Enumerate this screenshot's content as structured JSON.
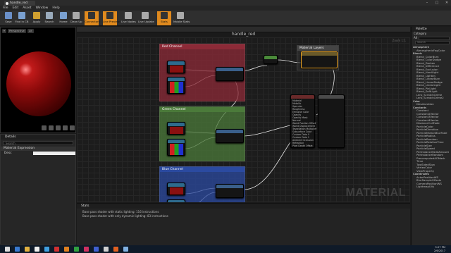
{
  "window": {
    "tab_title": "handle_red"
  },
  "menu": [
    "File",
    "Edit",
    "Asset",
    "Window",
    "Help"
  ],
  "toolbar": {
    "buttons": [
      {
        "label": "Save",
        "color": "#6a8fc7"
      },
      {
        "label": "Find in CB",
        "color": "#7aa0d0"
      },
      {
        "label": "Apply",
        "color": "#d0a030"
      },
      {
        "label": "Search",
        "color": "#9ab"
      },
      {
        "label": "Home",
        "color": "#7aa0d0"
      },
      {
        "label": "Clean Up",
        "color": "#aaa"
      },
      {
        "label": "Connectors",
        "color": "#333"
      },
      {
        "label": "Live Preview",
        "color": "#333"
      },
      {
        "label": "Live Nodes",
        "color": "#aaa"
      },
      {
        "label": "Live Update",
        "color": "#aaa"
      },
      {
        "label": "Stats",
        "color": "#333"
      },
      {
        "label": "Mobile Stats",
        "color": "#aaa"
      }
    ],
    "active": [
      "Connectors",
      "Live Preview",
      "Stats"
    ]
  },
  "viewport": {
    "buttons": [
      "Perspective",
      "Lit"
    ]
  },
  "details": {
    "tab": "Details",
    "search_placeholder": "Search",
    "section": "Material Expression",
    "prop_label": "Desc"
  },
  "graph": {
    "title": "handle_red",
    "zoom": "Zoom 1:1",
    "watermark": "MATERIAL",
    "comments": [
      {
        "label": "Red Channel",
        "color": "#8c2a37"
      },
      {
        "label": "Green Channel",
        "color": "#4b7a3a"
      },
      {
        "label": "Blue Channel",
        "color": "#2b4aa0"
      }
    ],
    "material_layers": "Material Layers",
    "pins": [
      "Material",
      "Metallic",
      "Specular",
      "Roughness",
      "Emissive Color",
      "Opacity",
      "Opacity Mask",
      "Normal",
      "World Position Offset",
      "World Displacement",
      "Tessellation Multiplier",
      "Subsurface Color",
      "Custom Data 0",
      "Custom Data 1",
      "Ambient Occlusion",
      "Refraction",
      "Pixel Depth Offset"
    ]
  },
  "output": {
    "tab": "Stats",
    "lines": [
      "Base pass shader with static lighting: 116 instructions",
      "Base pass shader with only dynamic lighting: 83 instructions"
    ]
  },
  "palette": {
    "tab": "Palette",
    "category_label": "Category",
    "category_value": "All",
    "search_placeholder": "Search",
    "groups": [
      {
        "name": "Atmosphere",
        "items": [
          "AtmosphericFogColor"
        ]
      },
      {
        "name": "Blends",
        "items": [
          "Blend_ColorBurn",
          "Blend_ColorDodge",
          "Blend_Darken",
          "Blend_Difference",
          "Blend_Exclusion",
          "Blend_HardLight",
          "Blend_Lighten",
          "Blend_LinearBurn",
          "Blend_LinearDodge",
          "Blend_LinearLight",
          "Blend_PinLight",
          "Blend_SoftLight",
          "Lerp_ScratchGrime",
          "Lerp_ScratchGrime2"
        ]
      },
      {
        "name": "Color",
        "items": [
          "Desaturation"
        ]
      },
      {
        "name": "Constants",
        "items": [
          "Constant",
          "Constant2Vector",
          "Constant3Vector",
          "Constant4Vector",
          "DistanceCullFade",
          "ParticleColor",
          "ParticleDirection",
          "ParticleMotionBlurFade",
          "ParticleRadius",
          "ParticleRandom",
          "ParticleRelativeTime",
          "ParticleSize",
          "ParticleSpeed",
          "PerInstanceFadeAmount",
          "PerInstanceRandom",
          "PrecomputedAOMask",
          "Time",
          "TwoSidedSign",
          "VertexColor",
          "ViewProperty"
        ]
      },
      {
        "name": "Coordinates",
        "items": [
          "ActorPositionWS",
          "BlurSampleOffsets",
          "CameraPositionWS",
          "LightmapUVs"
        ]
      }
    ]
  },
  "taskbar": {
    "time": "5:27 PM",
    "date": "2/6/2017"
  }
}
